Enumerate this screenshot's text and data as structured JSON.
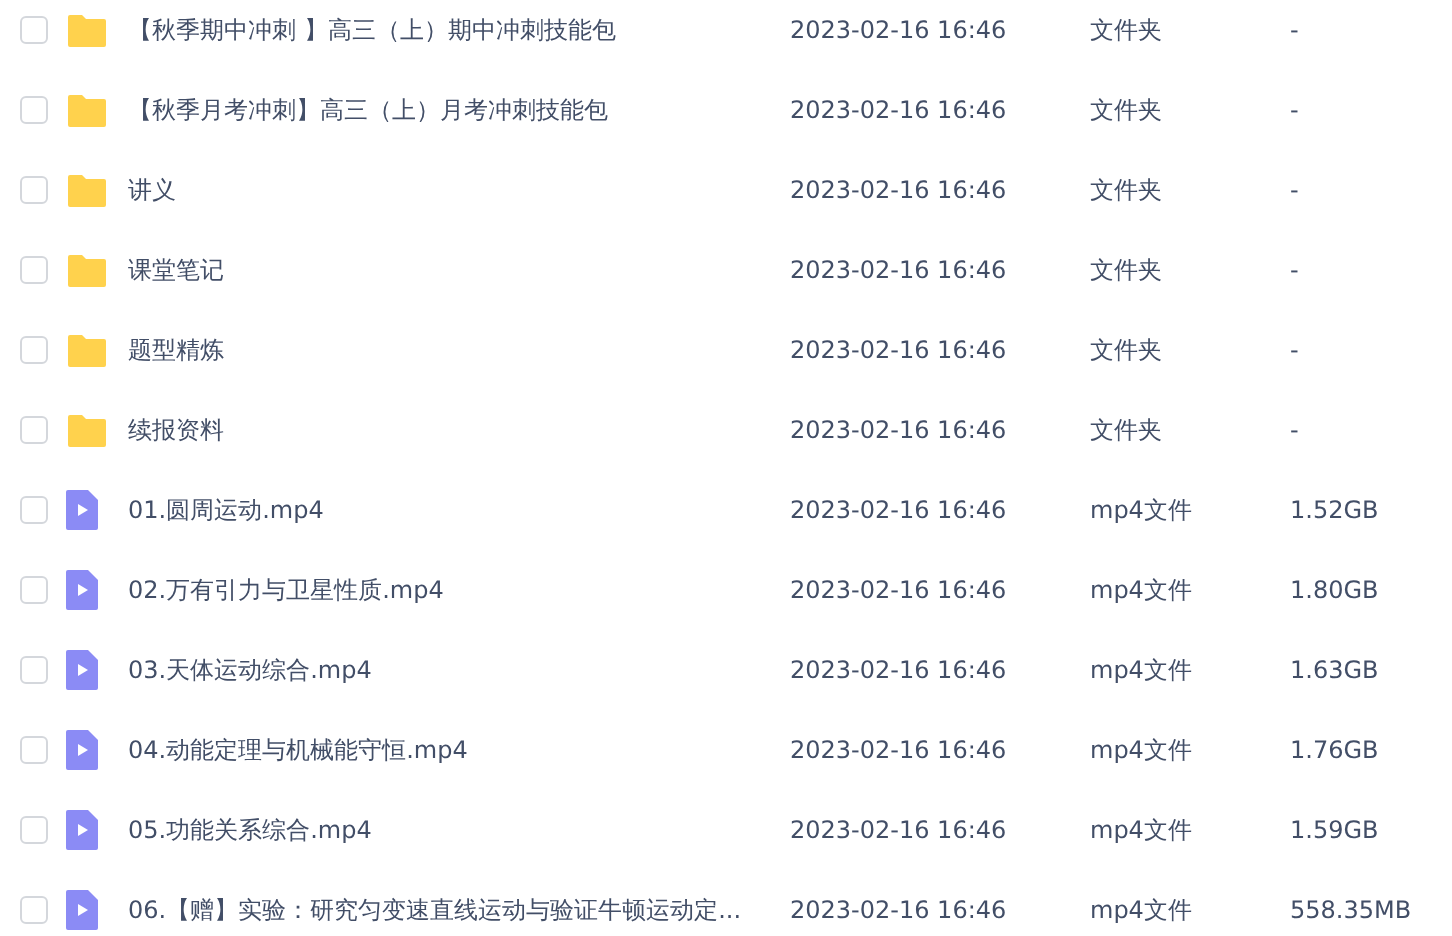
{
  "files": [
    {
      "kind": "folder",
      "checked": false,
      "name": "【秋季期中冲刺 】高三（上）期中冲刺技能包",
      "modified": "2023-02-16 16:46",
      "type": "文件夹",
      "size": "-"
    },
    {
      "kind": "folder",
      "checked": false,
      "name": "【秋季月考冲刺】高三（上）月考冲刺技能包",
      "modified": "2023-02-16 16:46",
      "type": "文件夹",
      "size": "-"
    },
    {
      "kind": "folder",
      "checked": false,
      "name": "讲义",
      "modified": "2023-02-16 16:46",
      "type": "文件夹",
      "size": "-"
    },
    {
      "kind": "folder",
      "checked": false,
      "name": "课堂笔记",
      "modified": "2023-02-16 16:46",
      "type": "文件夹",
      "size": "-"
    },
    {
      "kind": "folder",
      "checked": false,
      "name": "题型精炼",
      "modified": "2023-02-16 16:46",
      "type": "文件夹",
      "size": "-"
    },
    {
      "kind": "folder",
      "checked": false,
      "name": "续报资料",
      "modified": "2023-02-16 16:46",
      "type": "文件夹",
      "size": "-"
    },
    {
      "kind": "video",
      "checked": false,
      "name": "01.圆周运动.mp4",
      "modified": "2023-02-16 16:46",
      "type": "mp4文件",
      "size": "1.52GB"
    },
    {
      "kind": "video",
      "checked": false,
      "name": "02.万有引力与卫星性质.mp4",
      "modified": "2023-02-16 16:46",
      "type": "mp4文件",
      "size": "1.80GB"
    },
    {
      "kind": "video",
      "checked": false,
      "name": "03.天体运动综合.mp4",
      "modified": "2023-02-16 16:46",
      "type": "mp4文件",
      "size": "1.63GB"
    },
    {
      "kind": "video",
      "checked": false,
      "name": "04.动能定理与机械能守恒.mp4",
      "modified": "2023-02-16 16:46",
      "type": "mp4文件",
      "size": "1.76GB"
    },
    {
      "kind": "video",
      "checked": false,
      "name": "05.功能关系综合.mp4",
      "modified": "2023-02-16 16:46",
      "type": "mp4文件",
      "size": "1.59GB"
    },
    {
      "kind": "video",
      "checked": false,
      "name": "06.【赠】实验：研究匀变速直线运动与验证牛顿运动定...",
      "modified": "2023-02-16 16:46",
      "type": "mp4文件",
      "size": "558.35MB"
    }
  ]
}
